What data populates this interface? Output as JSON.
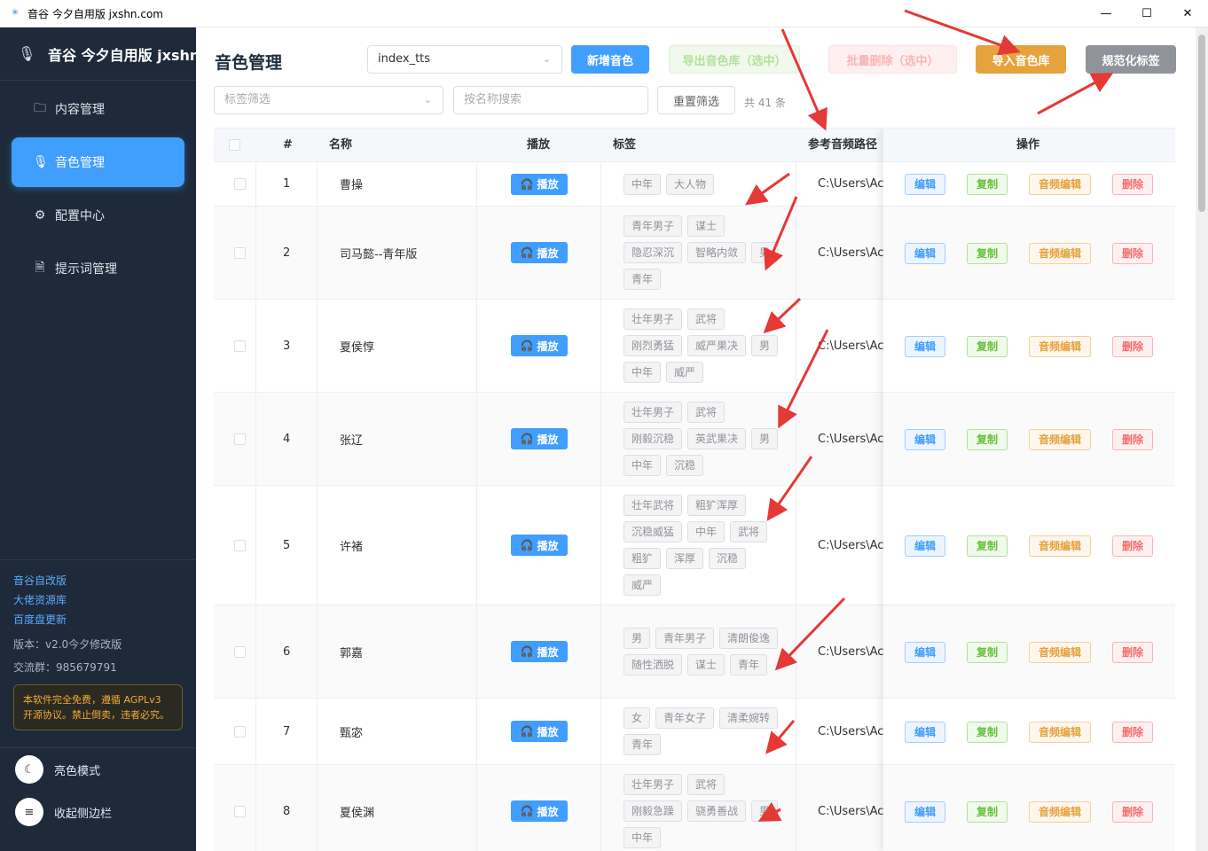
{
  "window": {
    "title": "音谷 今夕自用版 jxshn.com",
    "minimize": "—",
    "maximize": "☐",
    "close": "✕"
  },
  "sidebar": {
    "brand": "音谷 今夕自用版 jxshn.",
    "items": [
      {
        "label": "内容管理",
        "icon": "folder-icon",
        "glyph": "🗀"
      },
      {
        "label": "音色管理",
        "icon": "microphone-icon",
        "glyph": "🎙"
      },
      {
        "label": "配置中心",
        "icon": "gear-icon",
        "glyph": "⚙"
      },
      {
        "label": "提示词管理",
        "icon": "document-icon",
        "glyph": "🗎"
      }
    ],
    "links": [
      "音谷自改版",
      "大佬资源库",
      "百度盘更新"
    ],
    "version": "版本：v2.0今夕修改版",
    "group": "交流群：985679791",
    "license": "本软件完全免费，遵循 AGPLv3 开源协议。禁止倒卖，违者必究。",
    "actions": [
      {
        "label": "亮色模式",
        "icon": "moon-icon",
        "glyph": "☾"
      },
      {
        "label": "收起侧边栏",
        "icon": "collapse-icon",
        "glyph": "≡"
      }
    ]
  },
  "toolbar": {
    "page_title": "音色管理",
    "engine_select": "index_tts",
    "add_voice": "新增音色",
    "export": "导出音色库（选中）",
    "batch_delete": "批量删除（选中）",
    "import": "导入音色库",
    "normalize_tags": "规范化标签",
    "tag_filter_placeholder": "标签筛选",
    "search_placeholder": "按名称搜索",
    "reset": "重置筛选",
    "count": "共 41 条"
  },
  "table": {
    "headers": {
      "index": "#",
      "name": "名称",
      "play": "播放",
      "tags": "标签",
      "path": "参考音频路径",
      "ops": "操作"
    },
    "play_label": "播放",
    "ops": {
      "edit": "编辑",
      "copy": "复制",
      "audio_edit": "音频编辑",
      "delete": "删除"
    },
    "rows": [
      {
        "index": "1",
        "name": "曹操",
        "tags": [
          "中年",
          "大人物"
        ],
        "path": "C:\\Users\\Ac"
      },
      {
        "index": "2",
        "name": "司马懿--青年版",
        "tags": [
          "青年男子",
          "谋士",
          "隐忍深沉",
          "智略内敛",
          "男",
          "青年"
        ],
        "path": "C:\\Users\\Ac"
      },
      {
        "index": "3",
        "name": "夏侯惇",
        "tags": [
          "壮年男子",
          "武将",
          "刚烈勇猛",
          "威严果决",
          "男",
          "中年",
          "威严"
        ],
        "path": "C:\\Users\\Ac"
      },
      {
        "index": "4",
        "name": "张辽",
        "tags": [
          "壮年男子",
          "武将",
          "刚毅沉稳",
          "英武果决",
          "男",
          "中年",
          "沉稳"
        ],
        "path": "C:\\Users\\Ac"
      },
      {
        "index": "5",
        "name": "许褚",
        "tags": [
          "壮年武将",
          "粗犷浑厚",
          "沉稳威猛",
          "中年",
          "武将",
          "粗犷",
          "浑厚",
          "沉稳",
          "威严"
        ],
        "path": "C:\\Users\\Ac"
      },
      {
        "index": "6",
        "name": "郭嘉",
        "tags": [
          "男",
          "青年男子",
          "清朗俊逸",
          "随性洒脱",
          "谋士",
          "青年"
        ],
        "path": "C:\\Users\\Ac"
      },
      {
        "index": "7",
        "name": "甄宓",
        "tags": [
          "女",
          "青年女子",
          "清柔婉转",
          "青年"
        ],
        "path": "C:\\Users\\Ac"
      },
      {
        "index": "8",
        "name": "夏侯渊",
        "tags": [
          "壮年男子",
          "武将",
          "刚毅急躁",
          "骁勇善战",
          "男",
          "中年"
        ],
        "path": "C:\\Users\\Ac"
      }
    ]
  },
  "colors": {
    "primary": "#409eff",
    "sidebar": "#1e2a3a",
    "annotation_arrow": "#e53935"
  }
}
